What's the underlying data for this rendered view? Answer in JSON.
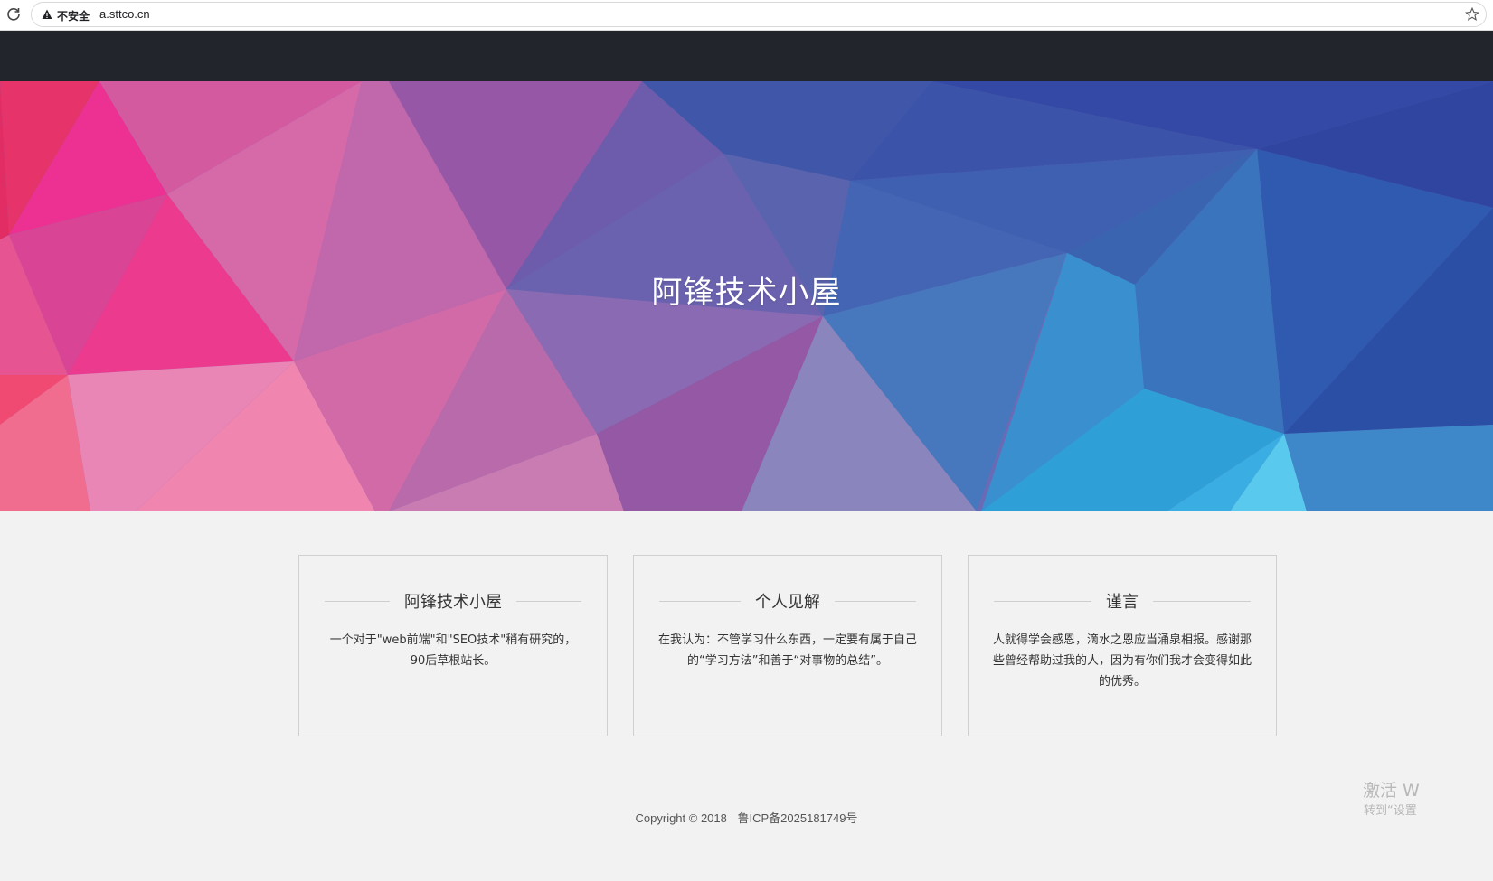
{
  "browser": {
    "security_label": "不安全",
    "url": "a.sttco.cn"
  },
  "hero": {
    "title": "阿锋技术小屋"
  },
  "cards": [
    {
      "title": "阿锋技术小屋",
      "text": "一个对于\"web前端\"和\"SEO技术\"稍有研究的，90后草根站长。"
    },
    {
      "title": "个人见解",
      "text": "在我认为：不管学习什么东西，一定要有属于自己的“学习方法”和善于“对事物的总结”。"
    },
    {
      "title": "谨言",
      "text": "人就得学会感恩，滴水之恩应当涌泉相报。感谢那些曾经帮助过我的人，因为有你们我才会变得如此的优秀。"
    }
  ],
  "footer": {
    "copyright": "Copyright © 2018",
    "icp": "鲁ICP备2025181749号"
  },
  "watermark": {
    "line1": "激活 W",
    "line2": "转到“设置"
  },
  "colors": {
    "topbar": "#22252c",
    "page_bg": "#f2f2f2"
  }
}
